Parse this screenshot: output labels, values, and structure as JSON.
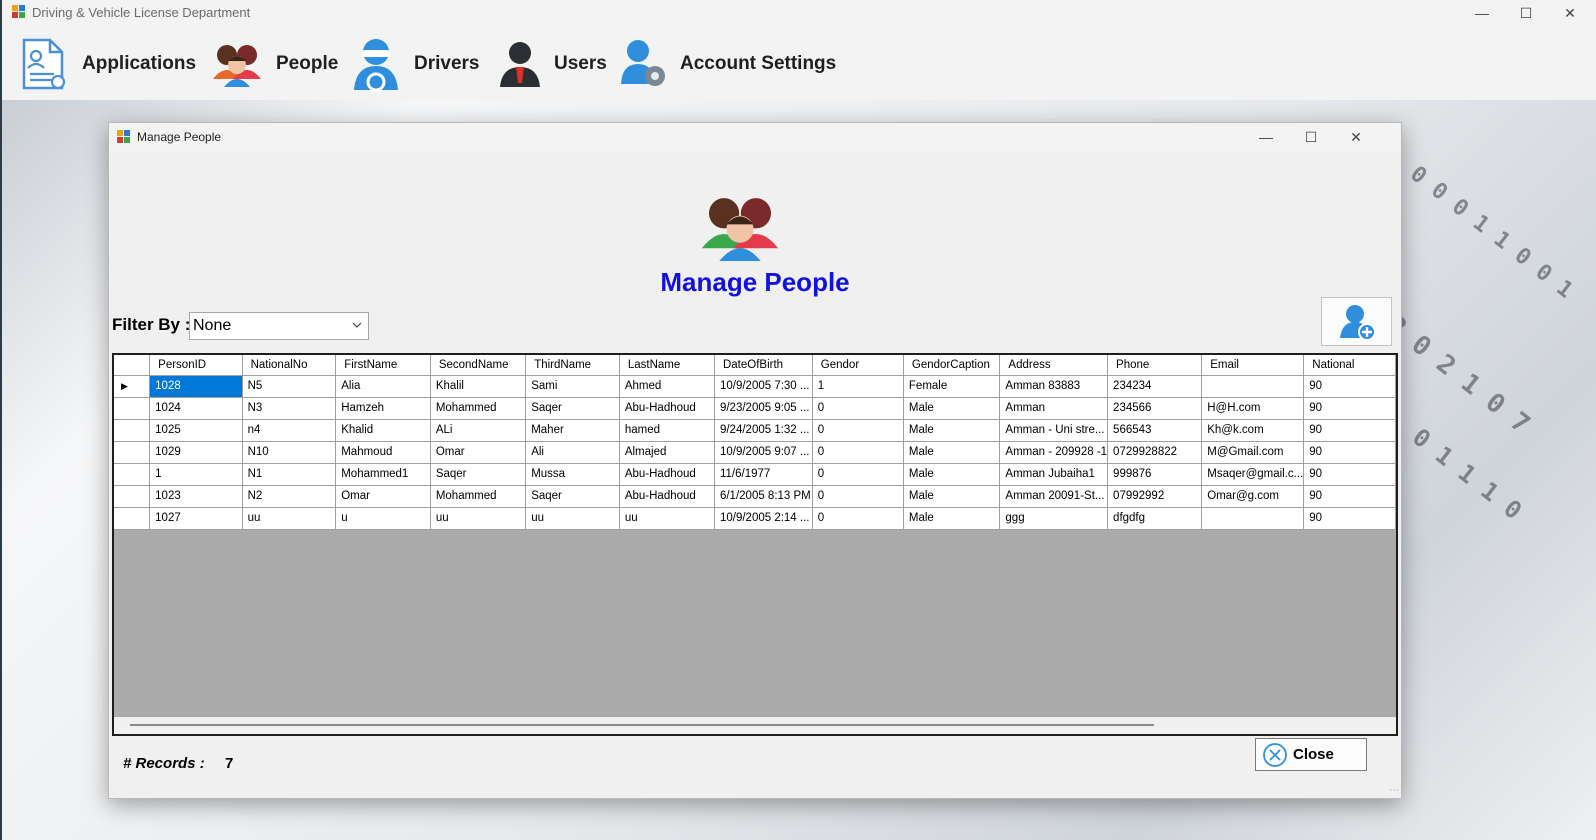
{
  "app": {
    "title": "Driving & Vehicle License Department"
  },
  "menu": [
    {
      "label": "Applications",
      "icon": "applications-icon"
    },
    {
      "label": "People",
      "icon": "people-icon"
    },
    {
      "label": "Drivers",
      "icon": "driver-icon"
    },
    {
      "label": "Users",
      "icon": "user-icon"
    },
    {
      "label": "Account Settings",
      "icon": "account-settings-icon"
    }
  ],
  "child_window": {
    "title": "Manage People",
    "heading": "Manage People",
    "filter": {
      "label": "Filter By :",
      "selected": "None"
    },
    "grid": {
      "columns": [
        "PersonID",
        "NationalNo",
        "FirstName",
        "SecondName",
        "ThirdName",
        "LastName",
        "DateOfBirth",
        "Gendor",
        "GendorCaption",
        "Address",
        "Phone",
        "Email",
        "National"
      ],
      "rows": [
        [
          "1028",
          "N5",
          "Alia",
          "Khalil",
          "Sami",
          "Ahmed",
          "10/9/2005 7:30 ...",
          "1",
          "Female",
          "Amman 83883",
          "234234",
          "",
          "90"
        ],
        [
          "1024",
          "N3",
          "Hamzeh",
          "Mohammed",
          "Saqer",
          "Abu-Hadhoud",
          "9/23/2005 9:05 ...",
          "0",
          "Male",
          "Amman",
          "234566",
          "H@H.com",
          "90"
        ],
        [
          "1025",
          "n4",
          "Khalid",
          "ALi",
          "Maher",
          "hamed",
          "9/24/2005 1:32 ...",
          "0",
          "Male",
          "Amman - Uni stre...",
          "566543",
          "Kh@k.com",
          "90"
        ],
        [
          "1029",
          "N10",
          "Mahmoud",
          "Omar",
          "Ali",
          "Almajed",
          "10/9/2005 9:07 ...",
          "0",
          "Male",
          "Amman - 209928 -1",
          "0729928822",
          "M@Gmail.com",
          "90"
        ],
        [
          "1",
          "N1",
          "Mohammed1",
          "Saqer",
          "Mussa",
          "Abu-Hadhoud",
          "11/6/1977",
          "0",
          "Male",
          "Amman Jubaiha1",
          "999876",
          "Msaqer@gmail.c...",
          "90"
        ],
        [
          "1023",
          "N2",
          "Omar",
          "Mohammed",
          "Saqer",
          "Abu-Hadhoud",
          "6/1/2005 8:13 PM",
          "0",
          "Male",
          "Amman 20091-St...",
          "07992992",
          "Omar@g.com",
          "90"
        ],
        [
          "1027",
          "uu",
          "u",
          "uu",
          "uu",
          "uu",
          "10/9/2005 2:14 ...",
          "0",
          "Male",
          "ggg",
          "dfgdfg",
          "",
          "90"
        ]
      ]
    },
    "records": {
      "label": "# Records :",
      "count": "7"
    },
    "close_label": "Close"
  },
  "colors": {
    "heading": "#1212e0",
    "selection": "#0078d7",
    "grid_empty": "#ababab"
  }
}
